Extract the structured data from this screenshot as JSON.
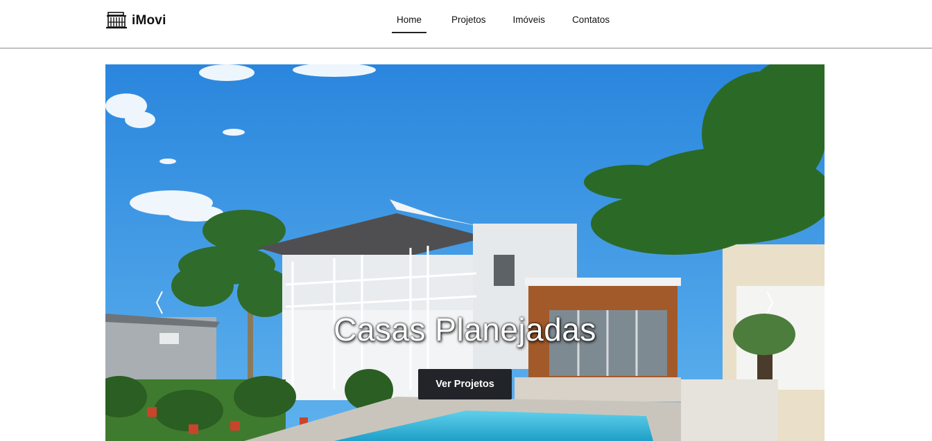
{
  "brand": {
    "name": "iMovi",
    "icon": "house-icon"
  },
  "nav": {
    "items": [
      {
        "label": "Home",
        "active": true
      },
      {
        "label": "Projetos",
        "active": false
      },
      {
        "label": "Imóveis",
        "active": false
      },
      {
        "label": "Contatos",
        "active": false
      }
    ]
  },
  "hero": {
    "caption": "Casas Planejadas",
    "button_label": "Ver Projetos",
    "prev_icon": "chevron-left-icon",
    "next_icon": "chevron-right-icon"
  },
  "colors": {
    "sky": "#3b93e0",
    "button_bg": "#212428",
    "text": "#111111"
  }
}
